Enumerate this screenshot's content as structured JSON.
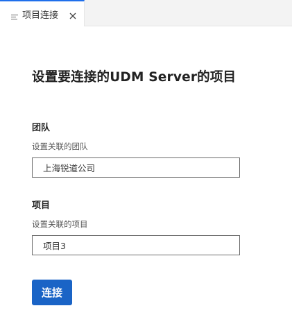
{
  "tab": {
    "label": "项目连接",
    "icon": "document-lines-icon",
    "close_icon": "close-icon"
  },
  "page": {
    "title": "设置要连接的UDM Server的项目"
  },
  "team": {
    "label": "团队",
    "description": "设置关联的团队",
    "value": "上海锐道公司"
  },
  "project": {
    "label": "项目",
    "description": "设置关联的项目",
    "value": "项目3"
  },
  "actions": {
    "connect_label": "连接"
  },
  "colors": {
    "accent": "#1a64c6",
    "tab_indicator": "#1f6feb"
  }
}
